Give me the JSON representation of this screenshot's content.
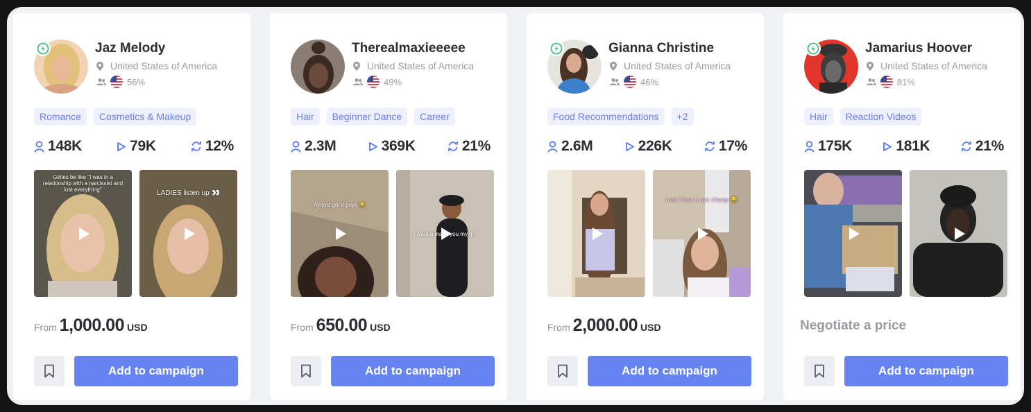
{
  "colors": {
    "accent": "#6583f1",
    "tag_bg": "#eef0fd",
    "tag_text": "#6a7ff0",
    "badge_green": "#3fbf83",
    "page_bg": "#f0f1f5"
  },
  "common": {
    "add_label": "Add to campaign",
    "from_label": "From",
    "currency": "USD"
  },
  "cards": [
    {
      "name": "Jaz Melody",
      "verified": true,
      "location": "United States of America",
      "audience_pct": "56%",
      "tags": [
        "Romance",
        "Cosmetics & Makeup"
      ],
      "followers": "148K",
      "views": "79K",
      "engagement": "12%",
      "videos": [
        {
          "caption": "Girlies be like \"I was in a relationship with a narcissist and lost everything\""
        },
        {
          "caption": "LADIES listen up 👀"
        }
      ],
      "price": "1,000.00",
      "negotiate": null
    },
    {
      "name": "Therealmaxieeeee",
      "verified": false,
      "location": "United States of America",
      "audience_pct": "49%",
      "tags": [
        "Hair",
        "Beginner Dance",
        "Career"
      ],
      "followers": "2.3M",
      "views": "369K",
      "engagement": "21%",
      "videos": [
        {
          "caption": "Almost got it guys 😂"
        },
        {
          "caption": "I wanna make you my girl"
        }
      ],
      "price": "650.00",
      "negotiate": null
    },
    {
      "name": "Gianna Christine",
      "verified": true,
      "location": "United States of America",
      "audience_pct": "46%",
      "tags": [
        "Food Recommendations",
        "+2"
      ],
      "followers": "2.6M",
      "views": "226K",
      "engagement": "17%",
      "videos": [
        {
          "caption": ""
        },
        {
          "caption": "how I live in nyc cheap 😂"
        }
      ],
      "price": "2,000.00",
      "negotiate": null
    },
    {
      "name": "Jamarius Hoover",
      "verified": true,
      "location": "United States of America",
      "audience_pct": "81%",
      "tags": [
        "Hair",
        "Reaction Videos"
      ],
      "followers": "175K",
      "views": "181K",
      "engagement": "21%",
      "videos": [
        {
          "caption": ""
        },
        {
          "caption": ""
        }
      ],
      "price": null,
      "negotiate": "Negotiate a price"
    }
  ]
}
